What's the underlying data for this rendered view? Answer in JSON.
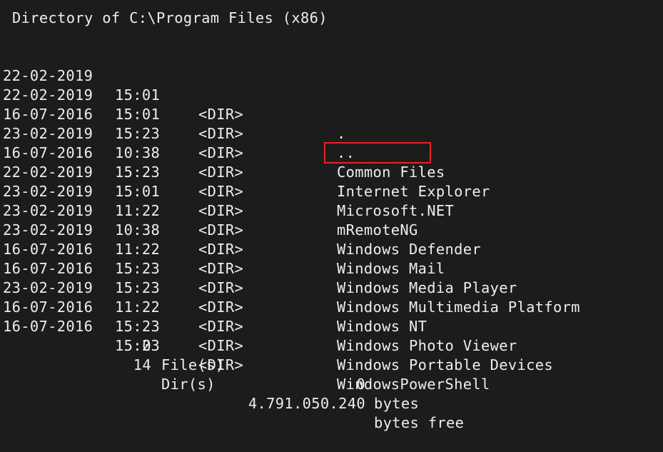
{
  "header": {
    "title": "Directory of C:\\Program Files (x86)"
  },
  "listing": [
    {
      "date": "22-02-2019",
      "time": "15:01",
      "type": "<DIR>",
      "name": "."
    },
    {
      "date": "22-02-2019",
      "time": "15:01",
      "type": "<DIR>",
      "name": ".."
    },
    {
      "date": "16-07-2016",
      "time": "15:23",
      "type": "<DIR>",
      "name": "Common Files"
    },
    {
      "date": "23-02-2019",
      "time": "10:38",
      "type": "<DIR>",
      "name": "Internet Explorer"
    },
    {
      "date": "16-07-2016",
      "time": "15:23",
      "type": "<DIR>",
      "name": "Microsoft.NET"
    },
    {
      "date": "22-02-2019",
      "time": "15:01",
      "type": "<DIR>",
      "name": "mRemoteNG"
    },
    {
      "date": "23-02-2019",
      "time": "11:22",
      "type": "<DIR>",
      "name": "Windows Defender"
    },
    {
      "date": "23-02-2019",
      "time": "10:38",
      "type": "<DIR>",
      "name": "Windows Mail"
    },
    {
      "date": "23-02-2019",
      "time": "11:22",
      "type": "<DIR>",
      "name": "Windows Media Player"
    },
    {
      "date": "16-07-2016",
      "time": "15:23",
      "type": "<DIR>",
      "name": "Windows Multimedia Platform"
    },
    {
      "date": "16-07-2016",
      "time": "15:23",
      "type": "<DIR>",
      "name": "Windows NT"
    },
    {
      "date": "23-02-2019",
      "time": "11:22",
      "type": "<DIR>",
      "name": "Windows Photo Viewer"
    },
    {
      "date": "16-07-2016",
      "time": "15:23",
      "type": "<DIR>",
      "name": "Windows Portable Devices"
    },
    {
      "date": "16-07-2016",
      "time": "15:23",
      "type": "<DIR>",
      "name": "WindowsPowerShell"
    }
  ],
  "summary": {
    "files_count": "0",
    "files_label": "File(s)",
    "files_bytes": "0",
    "files_bytes_unit": "bytes",
    "dirs_count": "14",
    "dirs_label": "Dir(s)",
    "dirs_bytes": "4.791.050.240",
    "dirs_bytes_unit": "bytes free"
  },
  "colors": {
    "background": "#1c1c1c",
    "text": "#ededed",
    "highlight": "#e8222b"
  }
}
